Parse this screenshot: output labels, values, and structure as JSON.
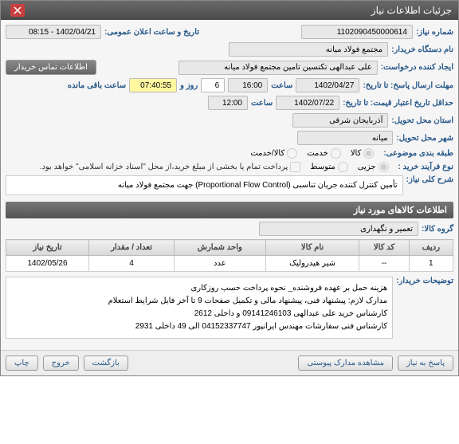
{
  "window": {
    "title": "جزئیات اطلاعات نیاز"
  },
  "fields": {
    "need_no_label": "شماره نیاز:",
    "need_no": "1102090450000614",
    "announce_label": "تاریخ و ساعت اعلان عمومی:",
    "announce_value": "1402/04/21 - 08:15",
    "buyer_org_label": "نام دستگاه خریدار:",
    "buyer_org": "مجتمع فولاد میانه",
    "requester_label": "ایجاد کننده درخواست:",
    "requester": "علی عبدالهی تکنسین تامین مجتمع فولاد میانه",
    "contact_btn": "اطلاعات تماس خریدار",
    "deadline_label": "مهلت ارسال پاسخ: تا تاریخ:",
    "deadline_date": "1402/04/27",
    "time_word": "ساعت",
    "deadline_time": "16:00",
    "days": "6",
    "days_word": "روز و",
    "remain_time": "07:40:55",
    "remain_word": "ساعت باقی مانده",
    "validity_label": "حداقل تاریخ اعتبار قیمت: تا تاریخ:",
    "validity_date": "1402/07/22",
    "validity_time": "12:00",
    "province_label": "استان محل تحویل:",
    "province": "آذربایجان شرقی",
    "city_label": "شهر محل تحویل:",
    "city": "میانه",
    "category_label": "طبقه بندی موضوعی:",
    "cat_goods": "کالا",
    "cat_service": "خدمت",
    "cat_both": "کالا/خدمت",
    "purchase_type_label": "نوع فرآیند خرید :",
    "pt_partial": "جزیی",
    "pt_medium": "متوسط",
    "note": "پرداخت تمام یا بخشی از مبلغ خرید،از محل \"اسناد خزانه اسلامی\" خواهد بود.",
    "desc_label": "شرح کلی نیاز:",
    "desc": "تأمین کنترل کننده جریان تناسبی (Proportional Flow Control) جهت مجتمع فولاد میانه",
    "items_header": "اطلاعات کالاهای مورد نیاز",
    "group_label": "گروه کالا:",
    "group": "تعمیر و نگهداری",
    "buyer_notes_label": "توضیحات خریدار:",
    "notes_l1": "هزینه حمل بر عهده فروشنده_ نحوه پرداخت حسب روزکاری",
    "notes_l2": "مدارک لازم: پیشنهاد فنی، پیشنهاد مالی و تکمیل صفحات 9 تا آخر فایل شرایط استعلام",
    "notes_l3": "کارشناس خرید علی عبدالهی 09141246103 و داخلی 2612",
    "notes_l4": "کارشناس فنی سفارشات مهندس ایرانپور 04152337747 الی 49 داخلی 2931"
  },
  "table": {
    "h_row": "ردیف",
    "h_code": "کد کالا",
    "h_name": "نام کالا",
    "h_unit": "واحد شمارش",
    "h_qty": "تعداد / مقدار",
    "h_date": "تاریخ نیاز",
    "r1_row": "1",
    "r1_code": "--",
    "r1_name": "شیر هیدرولیک",
    "r1_unit": "عدد",
    "r1_qty": "4",
    "r1_date": "1402/05/26"
  },
  "buttons": {
    "reply": "پاسخ به نیاز",
    "attachments": "مشاهده مدارک پیوستی",
    "back": "بازگشت",
    "exit": "خروج",
    "print": "چاپ"
  }
}
